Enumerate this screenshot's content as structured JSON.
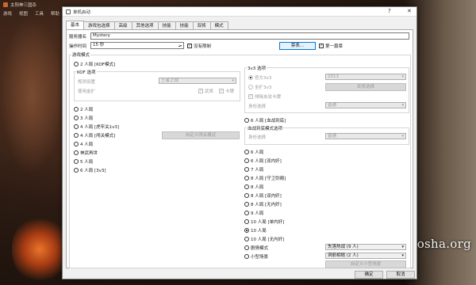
{
  "window": {
    "title": "太阳神三国杀",
    "menu": [
      "游戏",
      "视图",
      "工具",
      "帮助"
    ]
  },
  "dialog": {
    "title": "单机启动",
    "help": "?",
    "close": "✕",
    "tabs": [
      "基本",
      "游戏包选择",
      "高级",
      "其他选项",
      "技能",
      "技能",
      "双将",
      "模式"
    ],
    "server_name_label": "服务器名",
    "server_name_value": "Mystery",
    "timeout_label": "操作时间",
    "timeout_value": "15 秒",
    "no_limit": "没有限制",
    "ban_btn": "禁表...",
    "first_draw": "第一篇章",
    "game_mode_label": "游戏模式",
    "left": {
      "mode_2p_hulao": "2 人局 [KOF模式]",
      "kof_label": "KOF 选项",
      "rule_label": "规则设置",
      "rule_value": "王者之战",
      "use_ext_label": "使用金扩",
      "ext1": "武将",
      "ext2": "卡牌",
      "modes": [
        "2 人局",
        "3 人局",
        "4 人局 [虎牢关1v3]",
        "4 人局 [闯关模式]",
        "4 人局",
        "神武再世",
        "5 人局",
        "6 人局 [3v3]"
      ],
      "custom_btn": "自定义闯关模式"
    },
    "right": {
      "g33_label": "3v3 选项",
      "official": "官方3v3",
      "official_sel": "2013",
      "all33": "全扩3v3",
      "general_btn": "武将选择",
      "exclude": "排除夹攻卡牌",
      "role_label": "身份选择",
      "role_sel": "普通",
      "mode_6p_xiuxian": "6 人局 [血战到底]",
      "xiuxian_label": "血战到底模式选项",
      "xiuxian_role": "身份选择",
      "xiuxian_sel": "普通",
      "modes": [
        "6 人局",
        "6 人局 [双内奸]",
        "7 人局",
        "8 人局 [守卫剑阁]",
        "8 人局",
        "8 人局 [双内奸]",
        "8 人局 [无内奸]",
        "9 人局",
        "10 人局 [单内奸]",
        "10 人局",
        "10 人局 [无内奸]"
      ],
      "scenario": "剧情模式",
      "scenario_sel": "失落热战 (9 人)",
      "mini": "小型场景",
      "mini_sel": "洞箭相随 (2 人)",
      "mini_btn": "自定义小型场景"
    },
    "ok": "确定",
    "cancel": "取消"
  },
  "watermark": "guosha.org"
}
